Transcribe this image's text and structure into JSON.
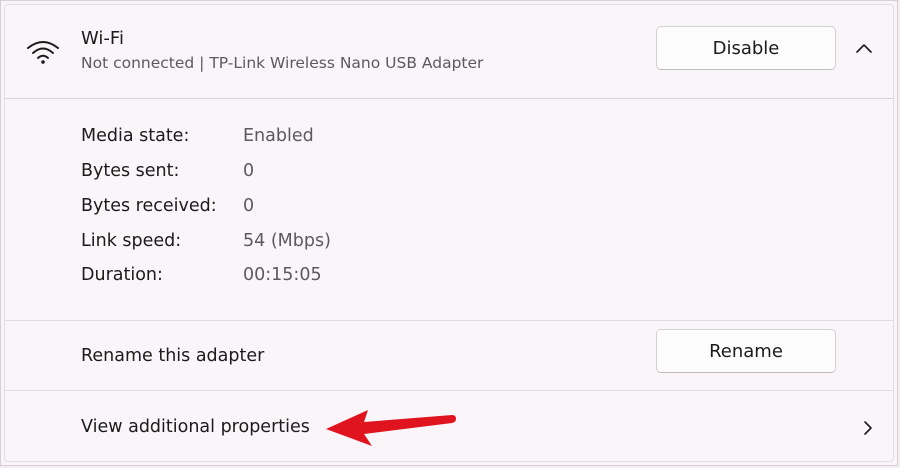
{
  "adapter": {
    "name": "Wi-Fi",
    "status": "Not connected | TP-Link Wireless Nano USB Adapter",
    "icon": "wifi-icon",
    "disable_label": "Disable",
    "collapse_icon": "chevron-up-icon"
  },
  "details": [
    {
      "label": "Media state:",
      "value": "Enabled"
    },
    {
      "label": "Bytes sent:",
      "value": "0"
    },
    {
      "label": "Bytes received:",
      "value": "0"
    },
    {
      "label": "Link speed:",
      "value": "54 (Mbps)"
    },
    {
      "label": "Duration:",
      "value": "00:15:05"
    }
  ],
  "rename": {
    "label": "Rename this adapter",
    "button_label": "Rename"
  },
  "view_properties": {
    "label": "View additional properties",
    "icon": "chevron-right-icon"
  },
  "annotation": {
    "arrow_color": "#e0141e"
  }
}
